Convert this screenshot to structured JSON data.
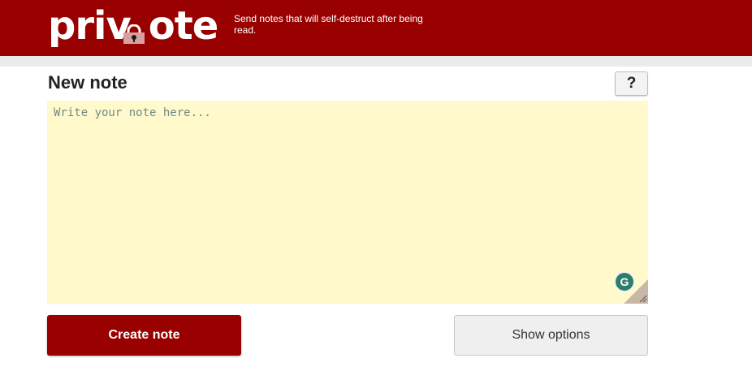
{
  "header": {
    "logo_left": "priv",
    "logo_right": "ote",
    "logo_icon": "lock-icon",
    "tagline": "Send notes that will self-destruct after being read."
  },
  "main": {
    "title": "New note",
    "help_label": "?",
    "note": {
      "value": "",
      "placeholder": "Write your note here..."
    },
    "grammarly_icon": "grammarly-icon",
    "grammarly_glyph": "G"
  },
  "actions": {
    "create_label": "Create note",
    "options_label": "Show options"
  },
  "colors": {
    "brand": "#990000",
    "note_bg": "#fff9cc",
    "options_bg": "#efefef"
  }
}
